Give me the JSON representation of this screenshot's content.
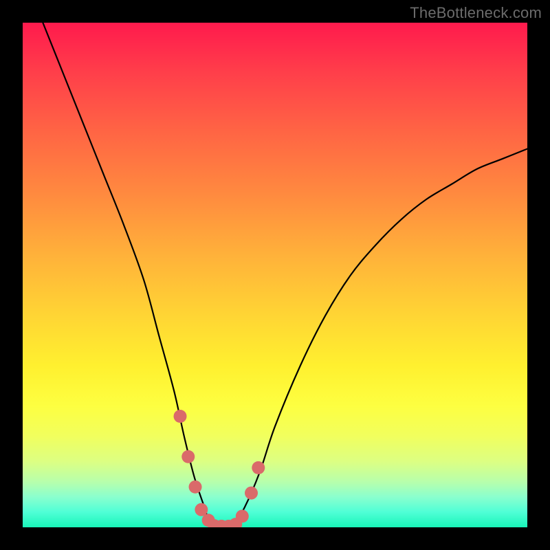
{
  "watermark": "TheBottleneck.com",
  "chart_data": {
    "type": "line",
    "title": "",
    "xlabel": "",
    "ylabel": "",
    "xlim": [
      0,
      100
    ],
    "ylim": [
      0,
      100
    ],
    "series": [
      {
        "name": "bottleneck-curve",
        "color": "#000000",
        "stroke_width": 2.2,
        "x": [
          4,
          8,
          12,
          16,
          20,
          24,
          27,
          30,
          32,
          34,
          36,
          37,
          38,
          40,
          42,
          44,
          47,
          50,
          55,
          60,
          65,
          70,
          75,
          80,
          85,
          90,
          95,
          100
        ],
        "y": [
          100,
          90,
          80,
          70,
          60,
          49,
          38,
          27,
          18,
          10,
          4,
          1,
          0,
          0,
          1,
          4,
          11,
          20,
          32,
          42,
          50,
          56,
          61,
          65,
          68,
          71,
          73,
          75
        ]
      },
      {
        "name": "highlight-dots",
        "color": "#da6a6a",
        "marker_size": 11,
        "points": [
          {
            "x": 31.2,
            "y": 22
          },
          {
            "x": 32.8,
            "y": 14
          },
          {
            "x": 34.2,
            "y": 8
          },
          {
            "x": 35.4,
            "y": 3.5
          },
          {
            "x": 36.8,
            "y": 1.4
          },
          {
            "x": 38.0,
            "y": 0.3
          },
          {
            "x": 39.4,
            "y": 0.2
          },
          {
            "x": 40.8,
            "y": 0.2
          },
          {
            "x": 42.2,
            "y": 0.6
          },
          {
            "x": 43.5,
            "y": 2.2
          },
          {
            "x": 45.3,
            "y": 6.8
          },
          {
            "x": 46.7,
            "y": 11.8
          }
        ]
      }
    ]
  }
}
